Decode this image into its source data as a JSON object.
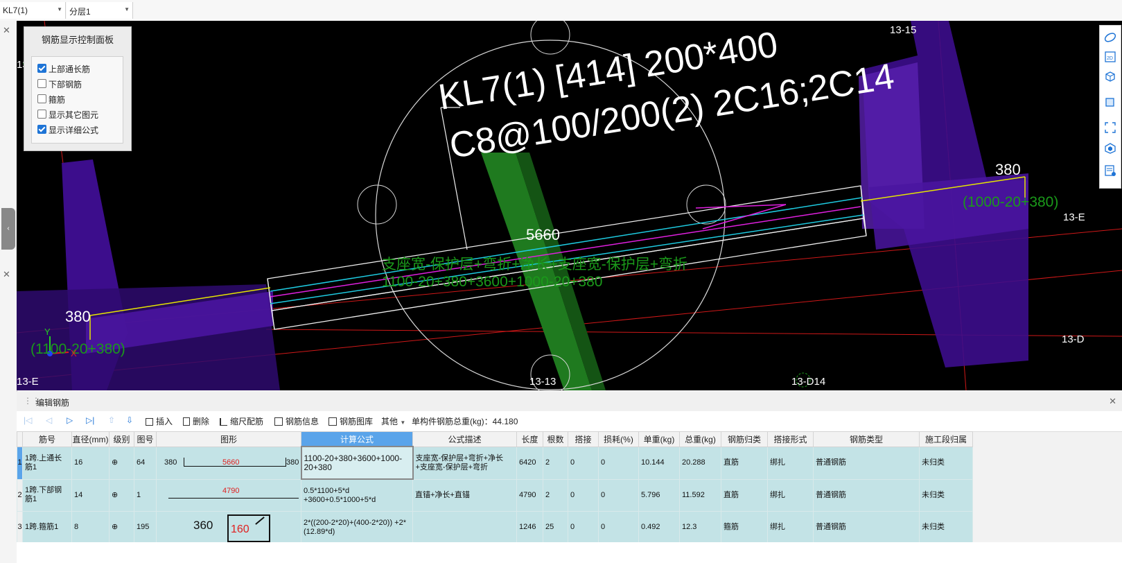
{
  "top": {
    "component_select": "KL7(1)",
    "layer_select": "分层1"
  },
  "viewport": {
    "annotation_line1": "KL7(1) [414] 200*400",
    "annotation_line2": "C8@100/200(2) 2C16;2C14",
    "length_label": "5660",
    "formula_desc": "支座宽-保护层+弯折+净长+支座宽-保护层+弯折",
    "formula_value": "1100-20+380+3600+1000-20+380",
    "left_bend": "380",
    "right_bend": "380",
    "left_bend_formula": "(1100-20+380)",
    "right_bend_formula": "(1000-20+380)",
    "axis_labels": {
      "a1": "13-15",
      "a2": "13-1",
      "a3": "13-E",
      "a4": "13-E",
      "a5": "13-D",
      "a6": "13-D14",
      "a7": "13-13"
    },
    "axes": {
      "y": "Y",
      "x": "X"
    },
    "colors": {
      "purple": "#3a0a8c",
      "green": "#1f7a1f",
      "yellow": "#e6e600",
      "cyan": "#1ecbe1",
      "magenta": "#e020e0",
      "red": "#ff2020"
    }
  },
  "control_panel": {
    "title": "钢筋显示控制面板",
    "items": [
      {
        "label": "上部通长筋",
        "checked": true
      },
      {
        "label": "下部钢筋",
        "checked": false
      },
      {
        "label": "箍筋",
        "checked": false
      },
      {
        "label": "显示其它图元",
        "checked": false
      },
      {
        "label": "显示详细公式",
        "checked": true
      }
    ]
  },
  "right_tools": [
    "sphere-icon",
    "2d-icon",
    "cube-icon",
    "cube-solid-icon",
    "fullscreen-icon",
    "box-icon",
    "report-icon"
  ],
  "panel": {
    "title": "编辑钢筋"
  },
  "toolbar": {
    "insert": "插入",
    "delete": "删除",
    "scale": "缩尺配筋",
    "info": "钢筋信息",
    "library": "钢筋图库",
    "other": "其他",
    "total_weight": "单构件钢筋总重(kg)：44.180"
  },
  "table": {
    "headers": [
      "筋号",
      "直径(mm)",
      "级别",
      "图号",
      "图形",
      "计算公式",
      "公式描述",
      "长度",
      "根数",
      "搭接",
      "损耗(%)",
      "单重(kg)",
      "总重(kg)",
      "钢筋归类",
      "搭接形式",
      "钢筋类型",
      "施工段归属"
    ],
    "rows": [
      {
        "num": "1",
        "name": "1跨.上通长筋1",
        "dia": "16",
        "grade": "⊕",
        "fig": "64",
        "shape": {
          "left": "380",
          "mid": "5660",
          "right": "380"
        },
        "formula": "1100-20+380+3600+1000-20+380",
        "desc": "支座宽-保护层+弯折+净长+支座宽-保护层+弯折",
        "len": "6420",
        "count": "2",
        "lap": "0",
        "loss": "0",
        "unit": "10.144",
        "total": "20.288",
        "cat": "直筋",
        "lapform": "绑扎",
        "type": "普通钢筋",
        "seg": "未归类"
      },
      {
        "num": "2",
        "name": "1跨.下部钢筋1",
        "dia": "14",
        "grade": "⊕",
        "fig": "1",
        "shape": {
          "mid": "4790"
        },
        "formula": "0.5*1100+5*d +3600+0.5*1000+5*d",
        "desc": "直锚+净长+直锚",
        "len": "4790",
        "count": "2",
        "lap": "0",
        "loss": "0",
        "unit": "5.796",
        "total": "11.592",
        "cat": "直筋",
        "lapform": "绑扎",
        "type": "普通钢筋",
        "seg": "未归类"
      },
      {
        "num": "3",
        "name": "1跨.箍筋1",
        "dia": "8",
        "grade": "⊕",
        "fig": "195",
        "shape": {
          "left": "360",
          "mid": "160"
        },
        "formula": "2*((200-2*20)+(400-2*20)) +2*(12.89*d)",
        "desc": "",
        "len": "1246",
        "count": "25",
        "lap": "0",
        "loss": "0",
        "unit": "0.492",
        "total": "12.3",
        "cat": "箍筋",
        "lapform": "绑扎",
        "type": "普通钢筋",
        "seg": "未归类"
      }
    ]
  }
}
